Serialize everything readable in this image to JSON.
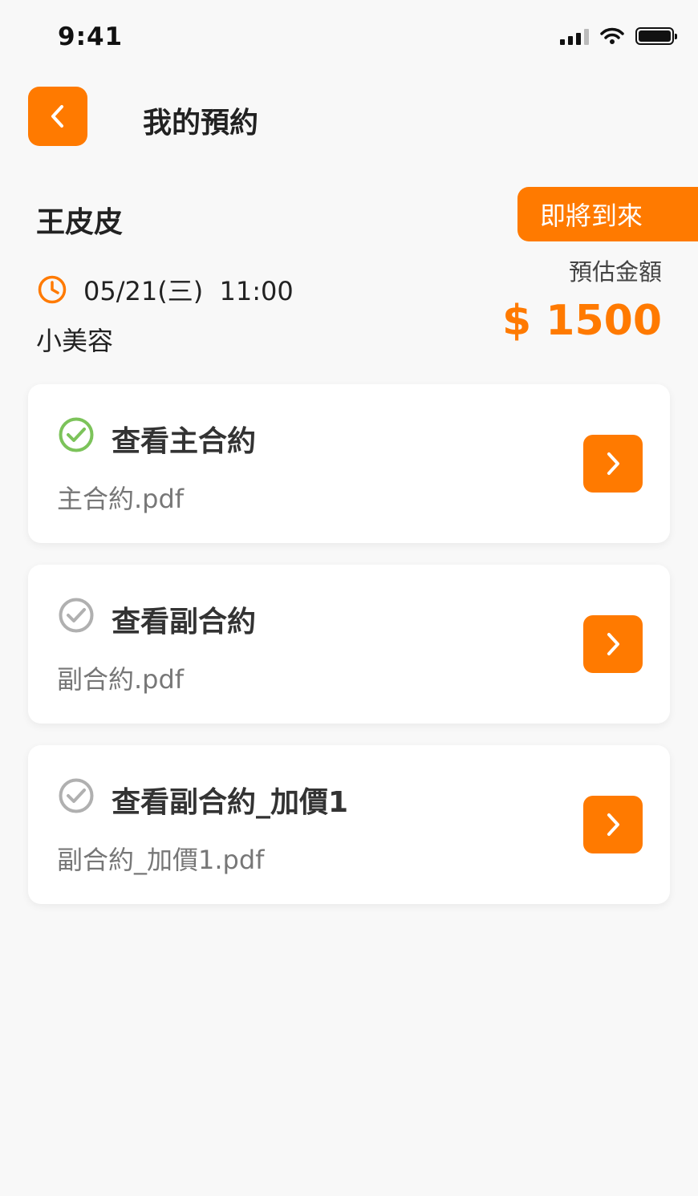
{
  "status_bar": {
    "time": "9:41"
  },
  "header": {
    "title": "我的預約"
  },
  "appointment": {
    "customer_name": "王皮皮",
    "status_badge": "即將到來",
    "datetime": "05/21(三)  11:00",
    "service": "小美容",
    "estimate_label": "預估金額",
    "estimate_amount": "$ 1500"
  },
  "documents": [
    {
      "title": "查看主合約",
      "file": "主合約.pdf",
      "checked": true
    },
    {
      "title": "查看副合約",
      "file": "副合約.pdf",
      "checked": false
    },
    {
      "title": "查看副合約_加價1",
      "file": "副合約_加價1.pdf",
      "checked": false
    }
  ],
  "colors": {
    "accent": "#ff7a00",
    "checked": "#7cc35a",
    "unchecked": "#b0b0b0"
  }
}
